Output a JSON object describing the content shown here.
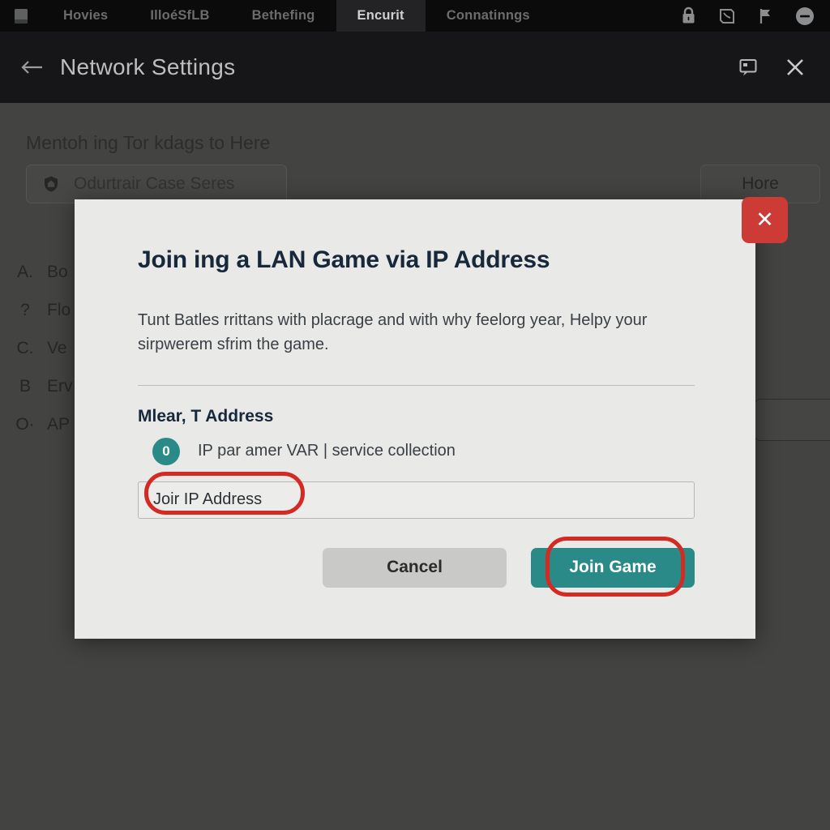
{
  "topbar": {
    "logo_icon": "book-icon",
    "tabs": [
      {
        "label": "Hovies",
        "active": false
      },
      {
        "label": "IlloéSfLB",
        "active": false
      },
      {
        "label": "Bethefing",
        "active": false
      },
      {
        "label": "Encurit",
        "active": true
      },
      {
        "label": "Connatinngs",
        "active": false
      }
    ],
    "icons": [
      {
        "name": "lock-icon",
        "glyph": "🔒"
      },
      {
        "name": "scroll-icon",
        "glyph": "⬚"
      },
      {
        "name": "flag-icon",
        "glyph": "⚑"
      },
      {
        "name": "minus-circle-icon",
        "glyph": "⊖"
      }
    ]
  },
  "pageheader": {
    "back_icon": "arrow-left-icon",
    "title": "Network Settings",
    "icons": [
      {
        "name": "comment-icon",
        "glyph": "🗩"
      },
      {
        "name": "close-icon",
        "glyph": "✕"
      }
    ]
  },
  "background": {
    "section_label": "Mentoh ing Tor kdags to Here",
    "chip_icon": "shield-home-icon",
    "chip_label": "Odurtrair Case Seres",
    "right_button_label": "Hore",
    "list": [
      {
        "marker": "A.",
        "label": "Bo"
      },
      {
        "marker": "?",
        "label": "Flo"
      },
      {
        "marker": "C.",
        "label": "Ve"
      },
      {
        "marker": "B",
        "label": "Erv"
      },
      {
        "marker": "O·",
        "label": "AP"
      }
    ]
  },
  "modal": {
    "close_label": "✕",
    "close_icon": "close-icon",
    "title": "Join ing a LAN Game via IP Address",
    "description": "Tunt Batles rrittans with placrage and with why feelorg year, Helpy your sirpwerem sfrim the game.",
    "field_label": "Mlear, T Address",
    "hint_badge": "0",
    "hint_text": "IP par amer VAR | service collection",
    "input_value": "Joir IP Address",
    "input_placeholder": "Joir IP Address",
    "cancel_label": "Cancel",
    "join_label": "Join Game"
  },
  "colors": {
    "accent_teal": "#2a8a87",
    "highlight_red": "#d32b24",
    "close_red": "#cc3b36",
    "modal_bg": "#e9e9e7",
    "page_bg": "#434341",
    "topbar_bg": "#0b0b0c",
    "header_bg": "#161618",
    "title_navy": "#16283a"
  }
}
